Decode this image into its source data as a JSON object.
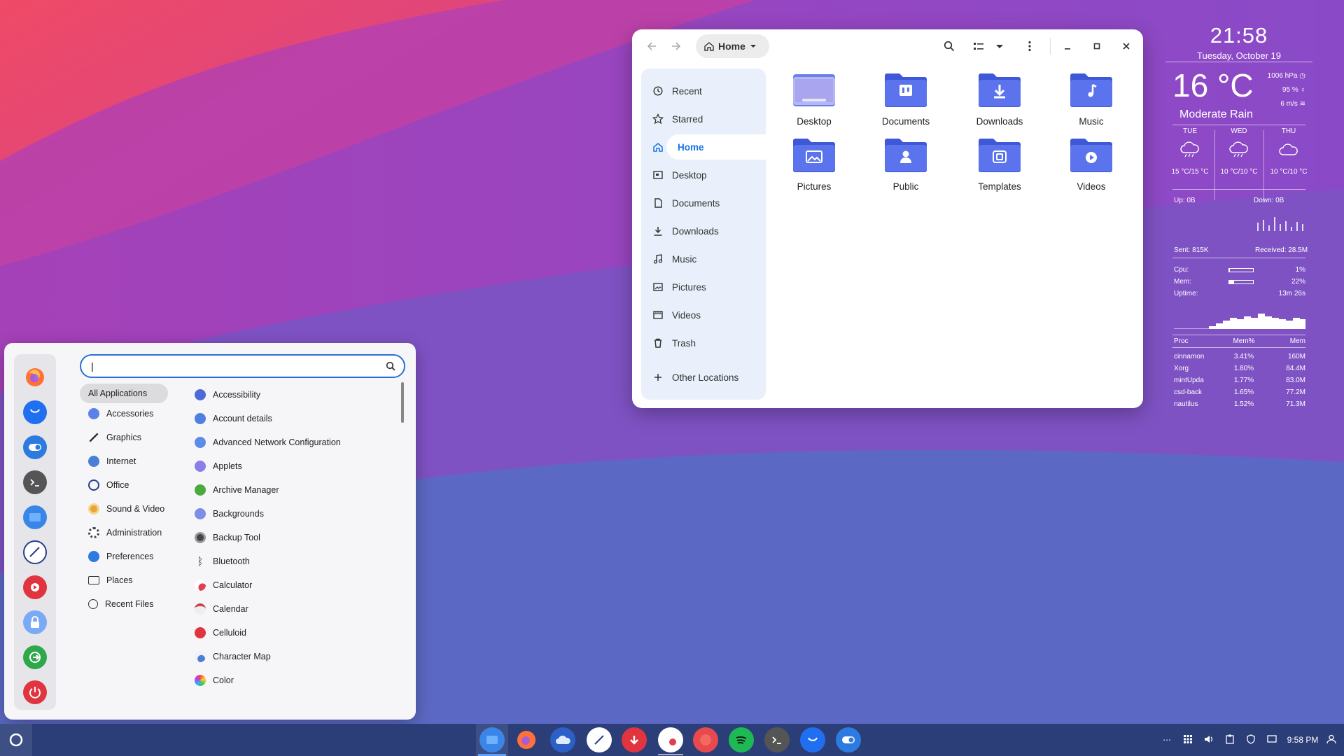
{
  "file_manager": {
    "path_label": "Home",
    "sidebar": [
      {
        "label": "Recent",
        "icon": "clock-icon"
      },
      {
        "label": "Starred",
        "icon": "star-icon"
      },
      {
        "label": "Home",
        "icon": "home-icon"
      },
      {
        "label": "Desktop",
        "icon": "desktop-icon"
      },
      {
        "label": "Documents",
        "icon": "document-icon"
      },
      {
        "label": "Downloads",
        "icon": "download-icon"
      },
      {
        "label": "Music",
        "icon": "music-icon"
      },
      {
        "label": "Pictures",
        "icon": "picture-icon"
      },
      {
        "label": "Videos",
        "icon": "video-icon"
      },
      {
        "label": "Trash",
        "icon": "trash-icon"
      },
      {
        "label": "Other Locations",
        "icon": "plus-icon"
      }
    ],
    "folders": [
      {
        "label": "Desktop",
        "icon": "desktop-folder-icon"
      },
      {
        "label": "Documents",
        "icon": "documents-folder-icon"
      },
      {
        "label": "Downloads",
        "icon": "downloads-folder-icon"
      },
      {
        "label": "Music",
        "icon": "music-folder-icon"
      },
      {
        "label": "Pictures",
        "icon": "pictures-folder-icon"
      },
      {
        "label": "Public",
        "icon": "public-folder-icon"
      },
      {
        "label": "Templates",
        "icon": "templates-folder-icon"
      },
      {
        "label": "Videos",
        "icon": "videos-folder-icon"
      }
    ]
  },
  "conky": {
    "time": "21:58",
    "date": "Tuesday, October 19",
    "temp": "16 °C",
    "pressure": "1006 hPa",
    "humidity": "95 %",
    "wind": "6 m/s",
    "condition": "Moderate Rain",
    "forecast": [
      {
        "day": "TUE",
        "temps": "15 °C/15 °C",
        "icon": "rain-cloud-icon"
      },
      {
        "day": "WED",
        "temps": "10 °C/10 °C",
        "icon": "rain-cloud-icon"
      },
      {
        "day": "THU",
        "temps": "10 °C/10 °C",
        "icon": "cloud-icon"
      }
    ],
    "up": "Up: 0B",
    "down": "Down: 0B",
    "sent": "Sent: 815K",
    "received": "Received: 28.5M",
    "cpu_label": "Cpu:",
    "cpu_value": "1%",
    "cpu_fraction": 0.01,
    "mem_label": "Mem:",
    "mem_value": "22%",
    "mem_fraction": 0.22,
    "uptime_label": "Uptime:",
    "uptime_value": "13m 26s",
    "proc_headers": [
      "Proc",
      "Mem%",
      "Mem"
    ],
    "procs": [
      [
        "cinnamon",
        "3.41%",
        "160M"
      ],
      [
        "Xorg",
        "1.80%",
        "84.4M"
      ],
      [
        "mintUpda",
        "1.77%",
        "83.0M"
      ],
      [
        "csd-back",
        "1.65%",
        "77.2M"
      ],
      [
        "nautilus",
        "1.52%",
        "71.3M"
      ]
    ]
  },
  "menu": {
    "search_value": "|",
    "categories": [
      "All Applications",
      "Accessories",
      "Graphics",
      "Internet",
      "Office",
      "Sound & Video",
      "Administration",
      "Preferences",
      "Places",
      "Recent Files"
    ],
    "apps": [
      "Accessibility",
      "Account details",
      "Advanced Network Configuration",
      "Applets",
      "Archive Manager",
      "Backgrounds",
      "Backup Tool",
      "Bluetooth",
      "Calculator",
      "Calendar",
      "Celluloid",
      "Character Map",
      "Color"
    ],
    "favorites": [
      "firefox-icon",
      "thunderbird-icon",
      "settings-toggle-icon",
      "terminal-icon",
      "files-icon",
      "text-editor-icon",
      "media-player-icon",
      "lock-icon",
      "logout-icon",
      "power-icon"
    ]
  },
  "panel": {
    "taskbar": [
      "files-icon",
      "firefox-icon",
      "cloud-icon",
      "text-editor-icon",
      "download-manager-icon",
      "image-viewer-icon",
      "web-app-icon",
      "spotify-icon",
      "terminal-icon",
      "thunderbird-icon",
      "settings-toggle-icon"
    ],
    "clock": "9:58 PM"
  }
}
